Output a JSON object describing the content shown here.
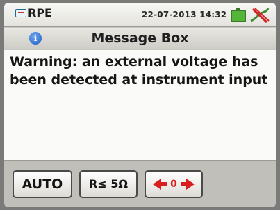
{
  "status_bar": {
    "mode": "RPE",
    "datetime": "22-07-2013 14:32",
    "icons": [
      "mode-icon",
      "battery-icon",
      "cable-icon"
    ]
  },
  "message_box": {
    "title": "Message Box",
    "icon": "info-icon",
    "message": "Warning: an external voltage has been detected at instrument input"
  },
  "bottom_buttons": {
    "auto_label": "AUTO",
    "limit_label": "R≤ 5Ω",
    "zero_label": "0",
    "zero_icon": "zero-calibration-arrows-icon"
  },
  "colors": {
    "screen_bg": "#c9c7c2",
    "message_bg": "#fafaf8",
    "info_blue": "#1e5fc4",
    "zero_red": "#d81e1e",
    "battery_green": "#55b43a"
  }
}
